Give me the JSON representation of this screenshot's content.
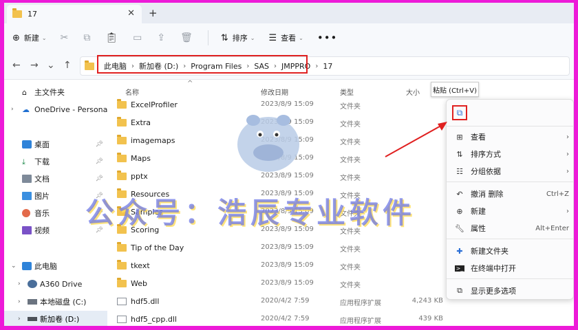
{
  "tab": {
    "title": "17"
  },
  "toolbar": {
    "new_label": "新建",
    "sort_label": "排序",
    "view_label": "查看"
  },
  "breadcrumb": [
    "此电脑",
    "新加卷 (D:)",
    "Program Files",
    "SAS",
    "JMPPRO",
    "17"
  ],
  "columns": {
    "name": "名称",
    "date": "修改日期",
    "type": "类型",
    "size": "大小"
  },
  "sidebar": {
    "home": "主文件夹",
    "onedrive": "OneDrive - Personal",
    "desktop": "桌面",
    "downloads": "下载",
    "documents": "文档",
    "pictures": "图片",
    "music": "音乐",
    "videos": "视频",
    "thispc": "此电脑",
    "a360": "A360 Drive",
    "cdrive": "本地磁盘 (C:)",
    "ddrive": "新加卷 (D:)"
  },
  "files": [
    {
      "name": "ExcelProfiler",
      "date": "2023/8/9 15:09",
      "type": "文件夹",
      "size": ""
    },
    {
      "name": "Extra",
      "date": "2023/8/9 15:09",
      "type": "文件夹",
      "size": ""
    },
    {
      "name": "imagemaps",
      "date": "2023/8/9 15:09",
      "type": "文件夹",
      "size": ""
    },
    {
      "name": "Maps",
      "date": "2023/8/9 15:09",
      "type": "文件夹",
      "size": ""
    },
    {
      "name": "pptx",
      "date": "2023/8/9 15:09",
      "type": "文件夹",
      "size": ""
    },
    {
      "name": "Resources",
      "date": "2023/8/9 15:09",
      "type": "文件夹",
      "size": ""
    },
    {
      "name": "Samples",
      "date": "2023/8/9 15:09",
      "type": "文件夹",
      "size": ""
    },
    {
      "name": "Scoring",
      "date": "2023/8/9 15:09",
      "type": "文件夹",
      "size": ""
    },
    {
      "name": "Tip of the Day",
      "date": "2023/8/9 15:09",
      "type": "文件夹",
      "size": ""
    },
    {
      "name": "tkext",
      "date": "2023/8/9 15:09",
      "type": "文件夹",
      "size": ""
    },
    {
      "name": "Web",
      "date": "2023/8/9 15:09",
      "type": "文件夹",
      "size": ""
    },
    {
      "name": "hdf5.dll",
      "date": "2020/4/2 7:59",
      "type": "应用程序扩展",
      "size": "4,243 KB"
    },
    {
      "name": "hdf5_cpp.dll",
      "date": "2020/4/2 7:59",
      "type": "应用程序扩展",
      "size": "439 KB"
    }
  ],
  "tooltip": "粘贴 (Ctrl+V)",
  "menu": {
    "view": "查看",
    "sort": "排序方式",
    "group": "分组依据",
    "undo": "撤消 删除",
    "undo_key": "Ctrl+Z",
    "new": "新建",
    "props": "属性",
    "props_key": "Alt+Enter",
    "newfolder": "新建文件夹",
    "terminal": "在终端中打开",
    "more": "显示更多选项"
  },
  "watermark": "公众号：浩辰专业软件",
  "colors": {
    "frame": "#ed1ad8",
    "highlight": "#e02020",
    "folder": "#f2c24e"
  }
}
